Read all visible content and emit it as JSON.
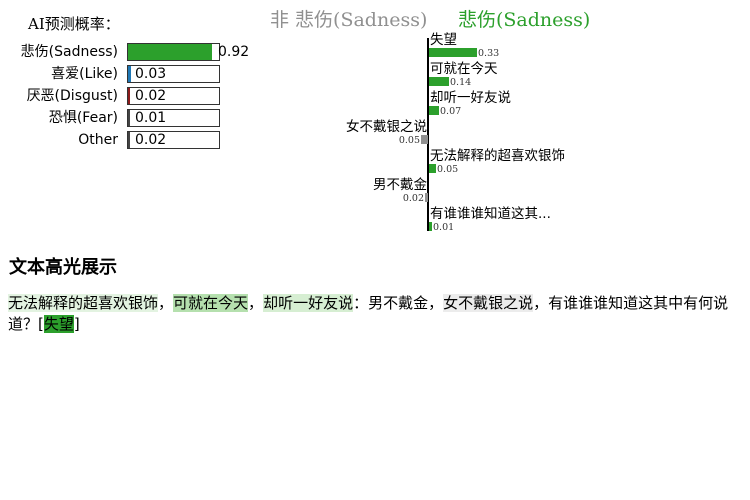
{
  "prob_panel": {
    "title": "AI预测概率：",
    "rows": [
      {
        "label": "悲伤(Sadness)",
        "value": 0.92,
        "value_text": "0.92",
        "color": "#2ca02c"
      },
      {
        "label": "喜爱(Like)",
        "value": 0.03,
        "value_text": "0.03",
        "color": "#1f77b4"
      },
      {
        "label": "厌恶(Disgust)",
        "value": 0.02,
        "value_text": "0.02",
        "color": "#8c1b1b"
      },
      {
        "label": "恐惧(Fear)",
        "value": 0.01,
        "value_text": "0.01",
        "color": "#444444"
      },
      {
        "label": "Other",
        "value": 0.02,
        "value_text": "0.02",
        "color": "#444444"
      }
    ]
  },
  "contrib": {
    "neg_header": "非 悲伤(Sadness)",
    "pos_header": "悲伤(Sadness)",
    "colors": {
      "pos": "#2ca02c",
      "neg": "#909090"
    },
    "items": [
      {
        "text": "失望",
        "value": 0.33,
        "value_text": "0.33",
        "side": "pos"
      },
      {
        "text": "可就在今天",
        "value": 0.14,
        "value_text": "0.14",
        "side": "pos"
      },
      {
        "text": "却听一好友说",
        "value": 0.07,
        "value_text": "0.07",
        "side": "pos"
      },
      {
        "text": "女不戴银之说",
        "value": 0.05,
        "value_text": "0.05",
        "side": "neg"
      },
      {
        "text": "无法解释的超喜欢银饰",
        "value": 0.05,
        "value_text": "0.05",
        "side": "pos"
      },
      {
        "text": "男不戴金",
        "value": 0.02,
        "value_text": "0.02",
        "side": "neg"
      },
      {
        "text": "有谁谁谁知道这其...",
        "value": 0.01,
        "value_text": "0.01",
        "side": "pos"
      }
    ]
  },
  "highlight": {
    "title": "文本高光展示",
    "segments": [
      {
        "text": "无法解释的超喜欢银饰",
        "bg": "#e3f3e1",
        "fg": "#000"
      },
      {
        "text": "，",
        "bg": "",
        "fg": "#000"
      },
      {
        "text": "可就在今天",
        "bg": "#b5e0ae",
        "fg": "#000"
      },
      {
        "text": "，",
        "bg": "",
        "fg": "#000"
      },
      {
        "text": "却听一好友说",
        "bg": "#d6eed2",
        "fg": "#000"
      },
      {
        "text": "：男不戴金，",
        "bg": "",
        "fg": "#000"
      },
      {
        "text": "女不戴银之说",
        "bg": "#ececec",
        "fg": "#000"
      },
      {
        "text": "，有谁谁谁知道这其中有何说道？[",
        "bg": "",
        "fg": "#000"
      },
      {
        "text": "失望",
        "bg": "#2ca02c",
        "fg": "#000"
      },
      {
        "text": "]",
        "bg": "",
        "fg": "#000"
      }
    ]
  }
}
